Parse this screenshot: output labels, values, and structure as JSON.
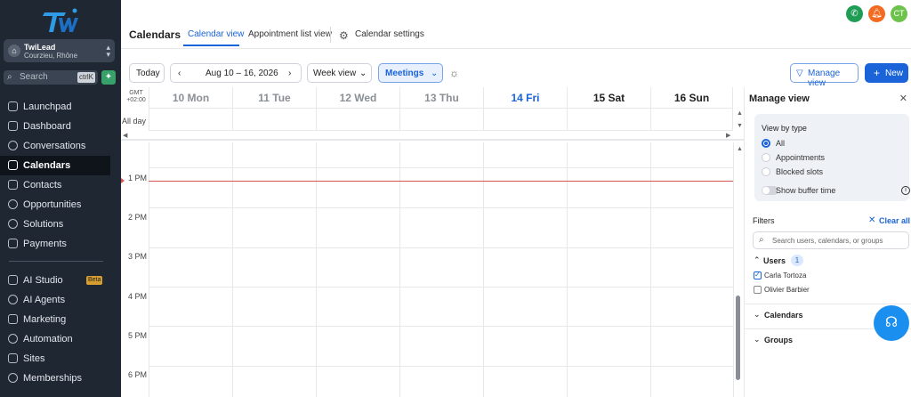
{
  "sidebar": {
    "logo_text": "TWI",
    "account": {
      "name": "TwiLead",
      "location": "Courzieu, Rhône"
    },
    "search": {
      "placeholder": "Search",
      "shortcut": "ctrlK"
    },
    "items": [
      {
        "label": "Launchpad",
        "icon": "rocket-icon"
      },
      {
        "label": "Dashboard",
        "icon": "dashboard-icon"
      },
      {
        "label": "Conversations",
        "icon": "chat-icon"
      },
      {
        "label": "Calendars",
        "icon": "calendar-icon",
        "active": true
      },
      {
        "label": "Contacts",
        "icon": "contacts-icon"
      },
      {
        "label": "Opportunities",
        "icon": "opportunities-icon"
      },
      {
        "label": "Solutions",
        "icon": "lightbulb-icon"
      },
      {
        "label": "Payments",
        "icon": "payments-icon"
      },
      {
        "label": "AI Studio",
        "icon": "ai-studio-icon",
        "badge": "Beta"
      },
      {
        "label": "AI Agents",
        "icon": "sparkle-icon"
      },
      {
        "label": "Marketing",
        "icon": "send-icon"
      },
      {
        "label": "Automation",
        "icon": "automation-icon"
      },
      {
        "label": "Sites",
        "icon": "sites-icon"
      },
      {
        "label": "Memberships",
        "icon": "memberships-icon"
      }
    ]
  },
  "header": {
    "title": "Calendars",
    "tabs": [
      {
        "label": "Calendar view",
        "active": true
      },
      {
        "label": "Appointment list view"
      },
      {
        "label": "Calendar settings"
      }
    ],
    "avatar_initials": "CT",
    "colors": {
      "phone": "#1f9d55",
      "bell": "#f36a21",
      "avatar": "#6cc24a"
    }
  },
  "toolbar": {
    "today": "Today",
    "date_range": "Aug 10 – 16, 2026",
    "view_select": "Week view",
    "type_select": "Meetings",
    "manage_view": "Manage view",
    "new": "New"
  },
  "calendar": {
    "gmt_label": "GMT",
    "gmt_offset": "+02:00",
    "all_day_label": "All day",
    "days": [
      {
        "label": "10 Mon",
        "muted": true
      },
      {
        "label": "11 Tue",
        "muted": true
      },
      {
        "label": "12 Wed",
        "muted": true
      },
      {
        "label": "13 Thu",
        "muted": true
      },
      {
        "label": "14 Fri",
        "today": true
      },
      {
        "label": "15 Sat"
      },
      {
        "label": "16 Sun"
      }
    ],
    "hours": [
      "1 PM",
      "2 PM",
      "3 PM",
      "4 PM",
      "5 PM",
      "6 PM"
    ]
  },
  "manage_view": {
    "title": "Manage view",
    "view_by_type": "View by type",
    "options": [
      {
        "label": "All",
        "selected": true
      },
      {
        "label": "Appointments"
      },
      {
        "label": "Blocked slots"
      }
    ],
    "buffer_toggle": "Show buffer time",
    "filters": "Filters",
    "clear_all": "Clear all",
    "search_placeholder": "Search users, calendars, or groups",
    "users": {
      "label": "Users",
      "count": "1",
      "items": [
        {
          "name": "Carla Tortoza",
          "checked": true
        },
        {
          "name": "Olivier Barbier",
          "checked": false
        }
      ]
    },
    "calendars": "Calendars",
    "groups": "Groups"
  }
}
